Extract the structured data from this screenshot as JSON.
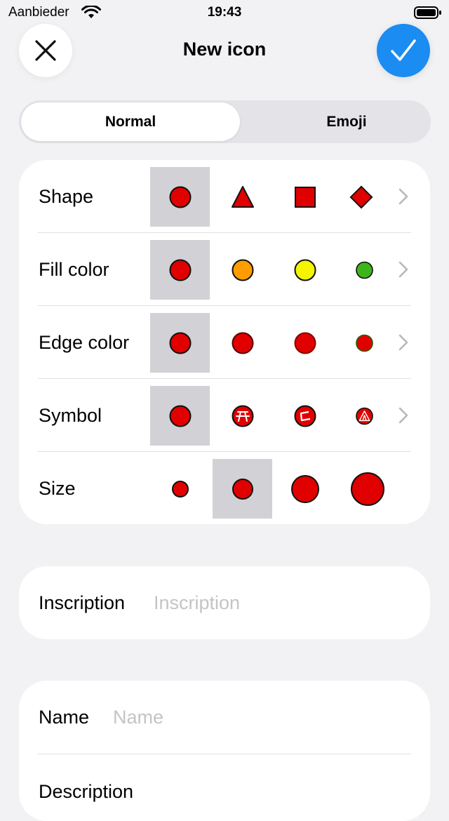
{
  "status_bar": {
    "carrier": "Aanbieder",
    "time": "19:43"
  },
  "header": {
    "title": "New icon",
    "close_icon": "close-icon",
    "confirm_icon": "checkmark-icon"
  },
  "segments": {
    "normal": "Normal",
    "emoji": "Emoji",
    "selected": "Normal"
  },
  "icon_options": {
    "shape": {
      "label": "Shape",
      "options": [
        "circle",
        "triangle",
        "square",
        "diamond"
      ],
      "selected": "circle"
    },
    "fill_color": {
      "label": "Fill color",
      "options": [
        "#e00000",
        "#ff9d00",
        "#f5f500",
        "#3db41a"
      ],
      "selected": "#e00000"
    },
    "edge_color": {
      "label": "Edge color",
      "options": [
        "#000000",
        "#550000",
        "#880000",
        "#2a5a00"
      ],
      "selected": "#000000"
    },
    "symbol": {
      "label": "Symbol",
      "options": [
        "none",
        "picnic-table-icon",
        "c-sign-icon",
        "camping-tent-icon"
      ],
      "selected": "none"
    },
    "size": {
      "label": "Size",
      "options": [
        "extra-small",
        "small",
        "medium",
        "large"
      ],
      "selected": "small"
    },
    "accent": "#e00000"
  },
  "inscription": {
    "label": "Inscription",
    "placeholder": "Inscription",
    "value": ""
  },
  "name": {
    "label": "Name",
    "placeholder": "Name",
    "value": ""
  },
  "description": {
    "label": "Description"
  },
  "colors": {
    "accent_blue": "#1a8cf2",
    "background": "#f2f2f4",
    "selection": "#d1d1d6"
  }
}
